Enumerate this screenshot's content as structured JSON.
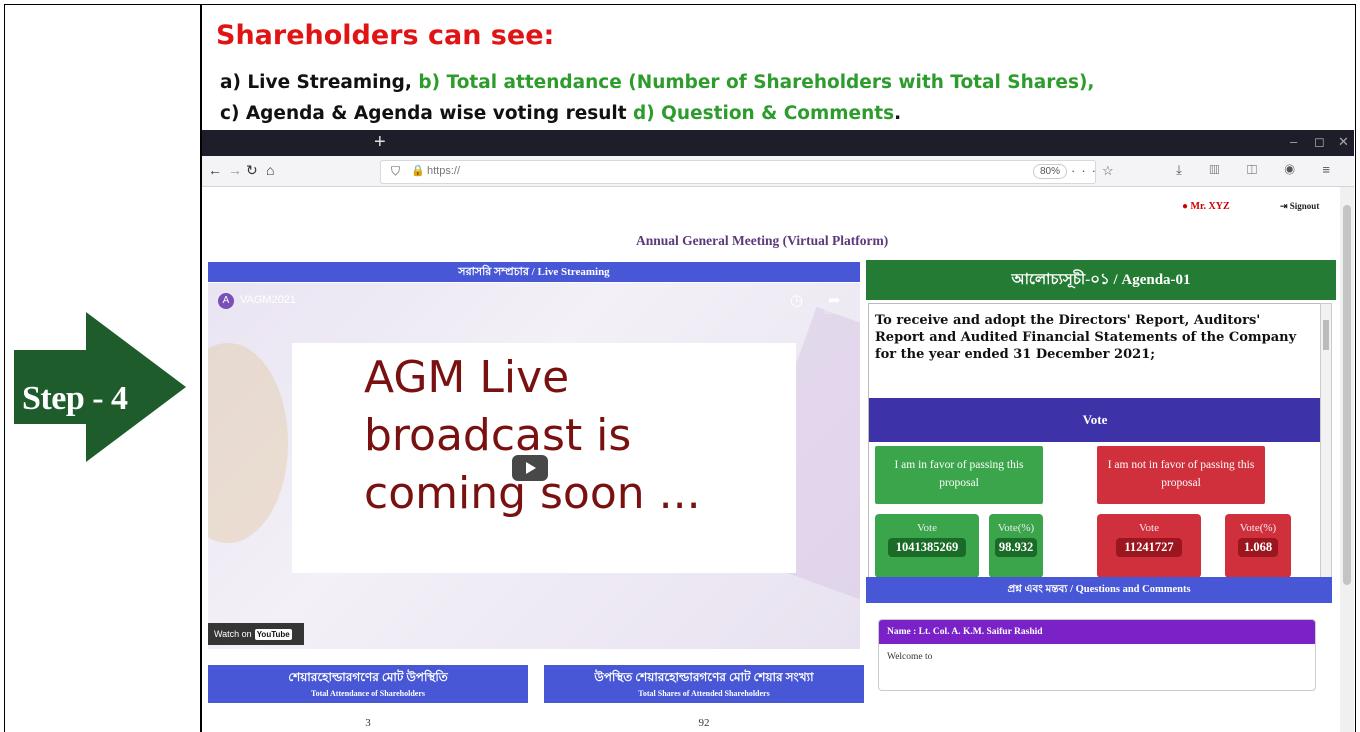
{
  "step_label": "Step - 4",
  "header": {
    "title": "Shareholders can see:",
    "line1_black_a": "a) Live Streaming, ",
    "line1_green": "b) Total attendance (Number of Shareholders with Total Shares),",
    "line2_black_a": "c) Agenda & Agenda wise voting result ",
    "line2_green": "d) Question & Comments",
    "line2_black_b": "."
  },
  "browser": {
    "url": "https://",
    "zoom": "80%"
  },
  "page": {
    "user": "Mr. XYZ",
    "signout": "Signout",
    "title": "Annual General Meeting (Virtual Platform)",
    "live_header": "সরাসরি সম্প্রচার / Live Streaming",
    "video": {
      "channel_initial": "A",
      "channel_name": "VAGM2021",
      "watch_later": "Watch later",
      "share": "Share",
      "slide_text": "AGM Live broadcast is coming soon ...",
      "watch_on": "Watch on",
      "youtube": "YouTube"
    },
    "attendance": [
      {
        "bn": "শেয়ারহোল্ডারগণের মোট উপস্থিতি",
        "en": "Total Attendance of Shareholders",
        "value": "3"
      },
      {
        "bn": "উপস্থিত শেয়ারহোল্ডারগণের মোট শেয়ার সংখ্যা",
        "en": "Total Shares of Attended Shareholders",
        "value": "92"
      }
    ],
    "agenda": {
      "header": "আলোচ্যসূচী-০১ / Agenda-01",
      "text": "To receive and adopt the Directors' Report, Auditors' Report and Audited Financial Statements of the Company for the year ended 31 December 2021;",
      "vote_header": "Vote",
      "favor_label": "I am in favor of passing this proposal",
      "against_label": "I am not in favor of passing this proposal",
      "favor_vote_label": "Vote",
      "favor_vote": "1041385269",
      "favor_pct_label": "Vote(%)",
      "favor_pct": "98.932",
      "against_vote_label": "Vote",
      "against_vote": "11241727",
      "against_pct_label": "Vote(%)",
      "against_pct": "1.068"
    },
    "qa": {
      "header": "প্রশ্ন এবং মন্তব্য / Questions and Comments",
      "name": "Name : Lt. Col. A. K.M. Saifur Rashid",
      "message": "Welcome to"
    }
  }
}
